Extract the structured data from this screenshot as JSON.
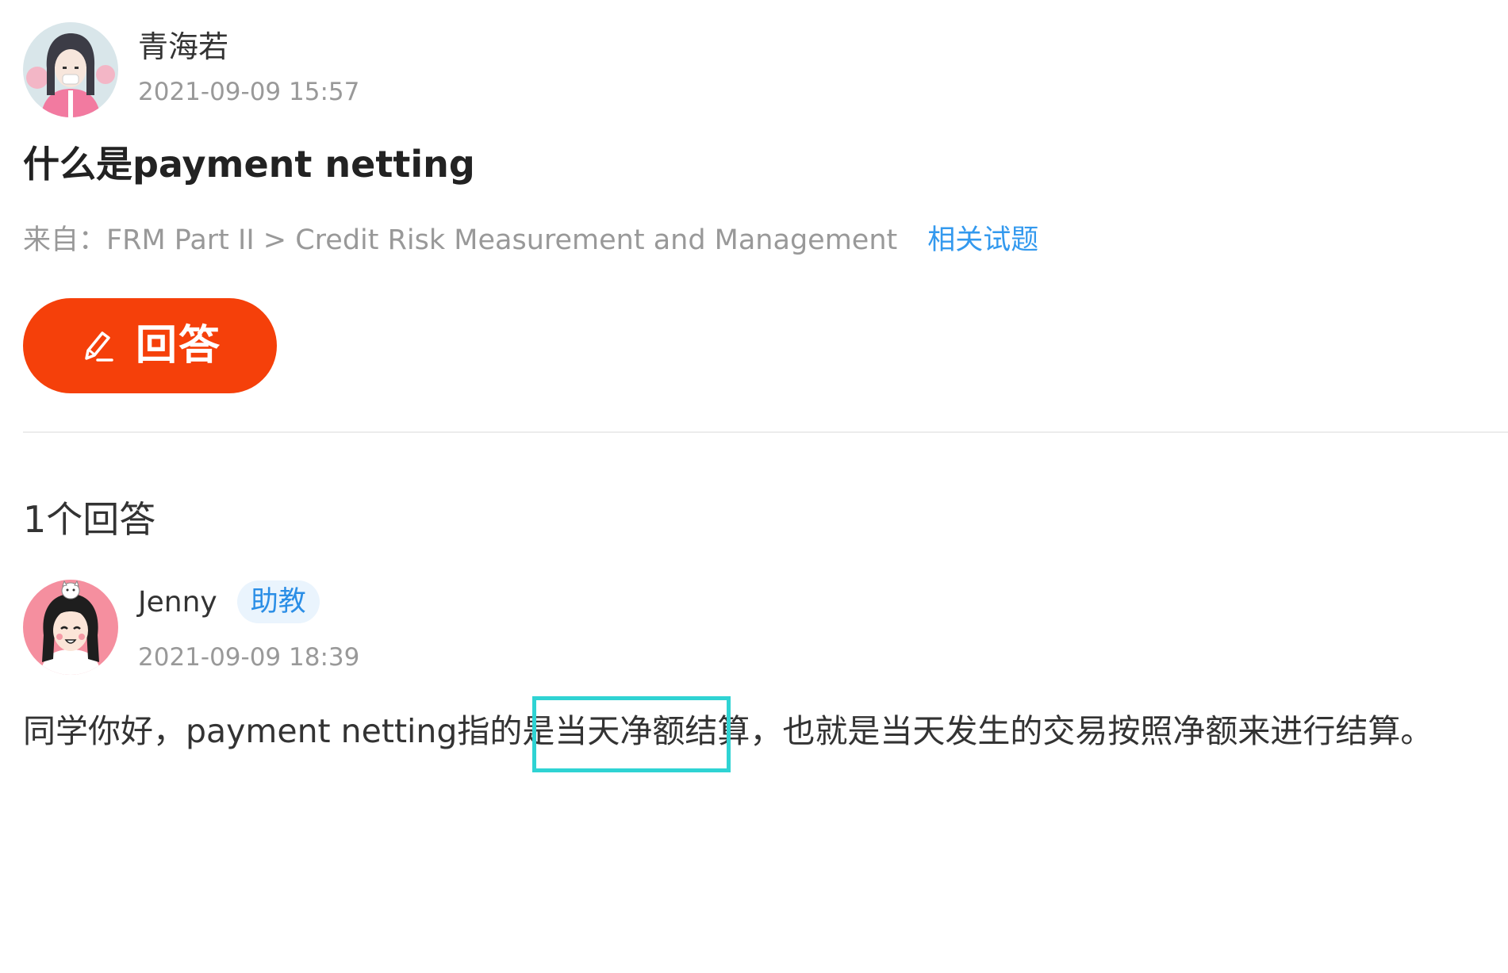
{
  "question": {
    "author": {
      "name": "青海若",
      "avatar": "female-illustrated-avatar",
      "time": "2021-09-09 15:57"
    },
    "title": "什么是payment netting",
    "source_label": "来自：",
    "source_path": "FRM Part II > Credit Risk Measurement and Management",
    "related_link": "相关试题"
  },
  "actions": {
    "answer_button_label": "回答",
    "answer_button_icon": "pencil-icon",
    "accent_color": "#f5400a"
  },
  "answers": {
    "heading": "1个回答",
    "items": [
      {
        "author": {
          "name": "Jenny",
          "avatar": "cartoon-girl-avatar",
          "role_badge": "助教",
          "time": "2021-09-09 18:39"
        },
        "content": "同学你好，payment netting指的是当天净额结算，也就是当天发生的交易按照净额来进行结算。",
        "highlighted_phrase": "当天净额结算"
      }
    ]
  },
  "colors": {
    "link": "#3399ee",
    "badge_text": "#2b8ee6",
    "badge_bg": "#eaf4fd",
    "highlight_border": "#2fd3d3",
    "muted_text": "#999999"
  }
}
